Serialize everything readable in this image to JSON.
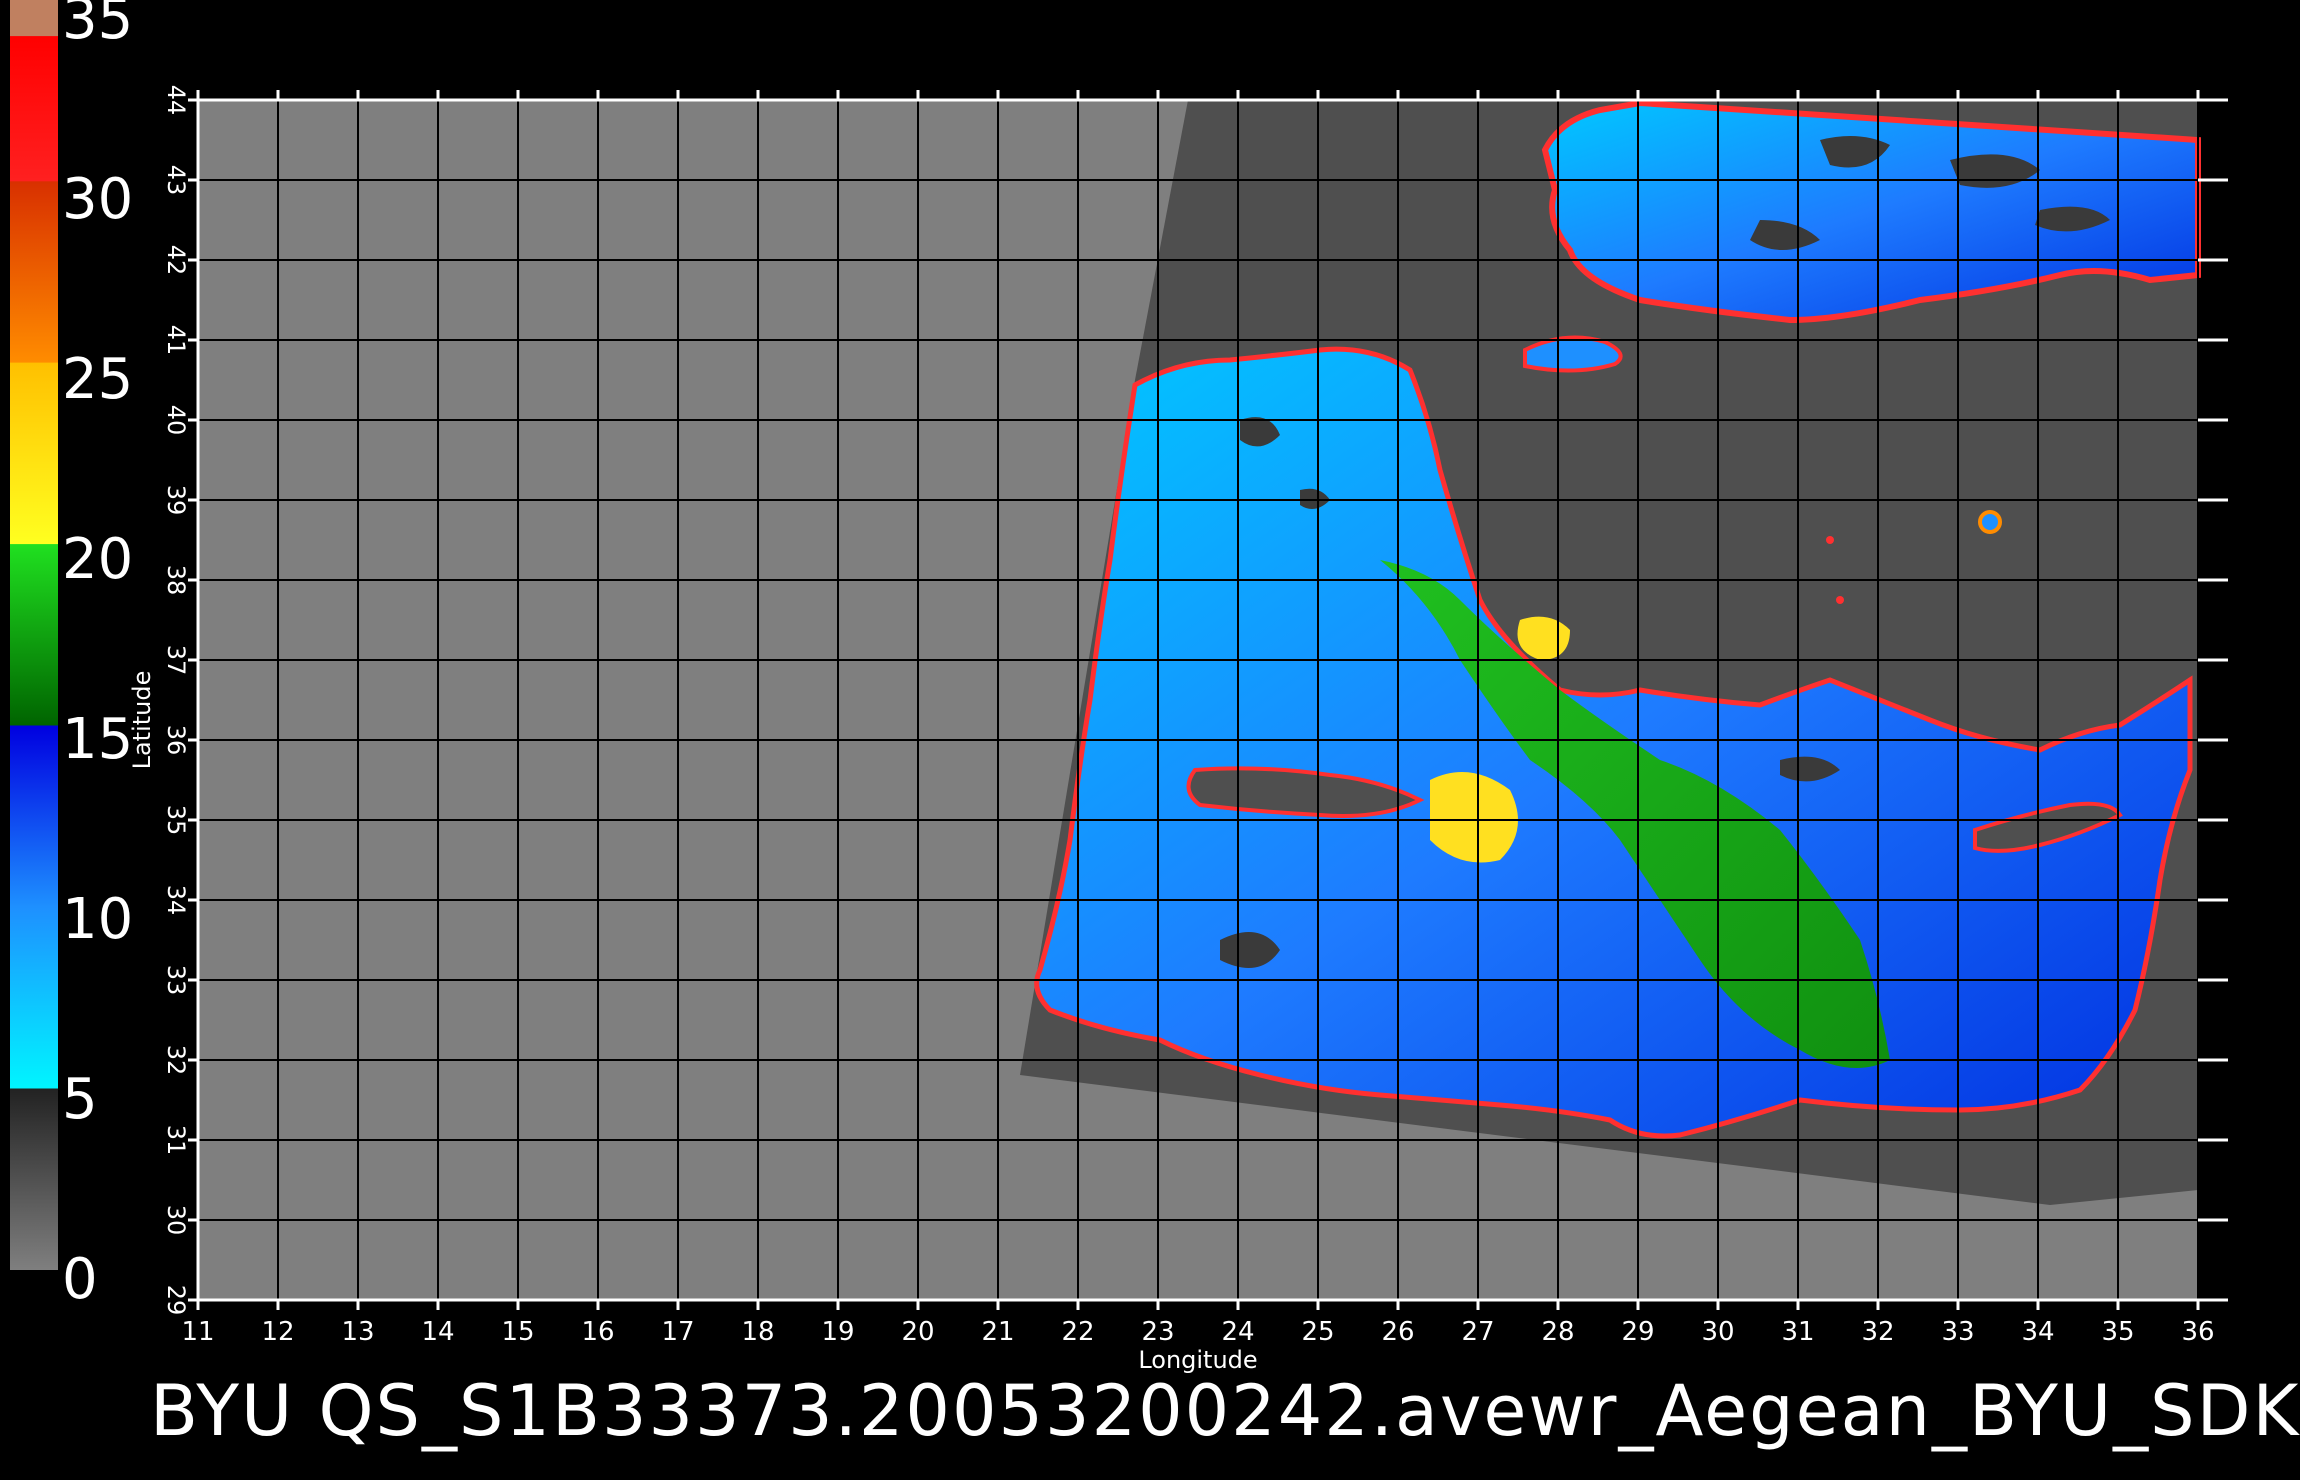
{
  "title": "BYU  QS_S1B33373.20053200242.avewr_Aegean_BYU_SDK",
  "colorbar": {
    "labels": [
      "35",
      "30",
      "25",
      "20",
      "15",
      "10",
      "5",
      "0"
    ],
    "stops": [
      {
        "value": 0,
        "color": "#7f7f7f"
      },
      {
        "value": 5,
        "color": "#222222"
      },
      {
        "value": 5.01,
        "color": "#00f5ff"
      },
      {
        "value": 10,
        "color": "#1e90ff"
      },
      {
        "value": 15,
        "color": "#0000e0"
      },
      {
        "value": 15.01,
        "color": "#006400"
      },
      {
        "value": 20,
        "color": "#20e020"
      },
      {
        "value": 20.01,
        "color": "#ffff20"
      },
      {
        "value": 25,
        "color": "#ffc000"
      },
      {
        "value": 25.01,
        "color": "#ff8c00"
      },
      {
        "value": 30,
        "color": "#d83000"
      },
      {
        "value": 30.01,
        "color": "#ff2020"
      },
      {
        "value": 34,
        "color": "#ff0000"
      },
      {
        "value": 34.01,
        "color": "#c08060"
      },
      {
        "value": 35,
        "color": "#c08060"
      }
    ]
  },
  "axes": {
    "xlabel": "Longitude",
    "ylabel": "Latitude",
    "xticks": [
      "11",
      "12",
      "13",
      "14",
      "15",
      "16",
      "17",
      "18",
      "19",
      "20",
      "21",
      "22",
      "23",
      "24",
      "25",
      "26",
      "27",
      "28",
      "29",
      "30",
      "31",
      "32",
      "33",
      "34",
      "35",
      "36"
    ],
    "yticks": [
      "29",
      "30",
      "31",
      "32",
      "33",
      "34",
      "35",
      "36",
      "37",
      "38",
      "39",
      "40",
      "41",
      "42",
      "43",
      "44"
    ],
    "xlim": [
      11,
      36
    ],
    "ylim": [
      29,
      44
    ]
  },
  "colors": {
    "background": "#000000",
    "map_fill": "#7f7f7f",
    "swath_fill": "#4f4f4f",
    "grid": "#000000"
  }
}
